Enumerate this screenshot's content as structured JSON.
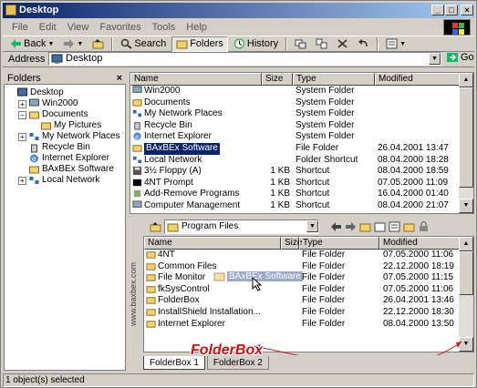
{
  "window": {
    "title": "Desktop"
  },
  "menu": [
    "File",
    "Edit",
    "View",
    "Favorites",
    "Tools",
    "Help"
  ],
  "toolbar": {
    "back": "Back",
    "search": "Search",
    "folders": "Folders",
    "history": "History"
  },
  "address": {
    "label": "Address",
    "value": "Desktop",
    "go": "Go"
  },
  "folders_pane": {
    "title": "Folders",
    "tree": [
      {
        "label": "Desktop",
        "depth": 0,
        "exp": ""
      },
      {
        "label": "Win2000",
        "depth": 1,
        "exp": "+"
      },
      {
        "label": "Documents",
        "depth": 1,
        "exp": "-"
      },
      {
        "label": "My Pictures",
        "depth": 2,
        "exp": ""
      },
      {
        "label": "My Network Places",
        "depth": 1,
        "exp": "+"
      },
      {
        "label": "Recycle Bin",
        "depth": 1,
        "exp": ""
      },
      {
        "label": "Internet Explorer",
        "depth": 1,
        "exp": ""
      },
      {
        "label": "BAxBEx Software",
        "depth": 1,
        "exp": ""
      },
      {
        "label": "Local Network",
        "depth": 1,
        "exp": "+"
      }
    ]
  },
  "list": {
    "columns": [
      "Name",
      "Size",
      "Type",
      "Modified"
    ],
    "rows": [
      {
        "name": "Win2000",
        "size": "",
        "type": "System Folder",
        "modified": ""
      },
      {
        "name": "Documents",
        "size": "",
        "type": "System Folder",
        "modified": ""
      },
      {
        "name": "My Network Places",
        "size": "",
        "type": "System Folder",
        "modified": ""
      },
      {
        "name": "Recycle Bin",
        "size": "",
        "type": "System Folder",
        "modified": ""
      },
      {
        "name": "Internet Explorer",
        "size": "",
        "type": "System Folder",
        "modified": ""
      },
      {
        "name": "BAxBEx Software",
        "size": "",
        "type": "File Folder",
        "modified": "26.04.2001 13:47"
      },
      {
        "name": "Local Network",
        "size": "",
        "type": "Folder Shortcut",
        "modified": "08.04.2000 18:28"
      },
      {
        "name": "3½ Floppy (A)",
        "size": "1 KB",
        "type": "Shortcut",
        "modified": "08.04.2000 18:59"
      },
      {
        "name": "4NT Prompt",
        "size": "1 KB",
        "type": "Shortcut",
        "modified": "07.05.2000 11:09"
      },
      {
        "name": "Add-Remove Programs",
        "size": "1 KB",
        "type": "Shortcut",
        "modified": "16.04.2000 01:40"
      },
      {
        "name": "Computer Management",
        "size": "1 KB",
        "type": "Shortcut",
        "modified": "08.04.2000 21:07"
      }
    ]
  },
  "folderbox": {
    "path": "Program Files",
    "side_label": "www.baxbex.com",
    "columns": [
      "Name",
      "Size",
      "Type",
      "Modified"
    ],
    "rows": [
      {
        "name": "4NT",
        "type": "File Folder",
        "modified": "07.05.2000 11:06"
      },
      {
        "name": "Common Files",
        "type": "File Folder",
        "modified": "22.12.2000 18:19"
      },
      {
        "name": "File Monitor",
        "type": "File Folder",
        "modified": "07.05.2000 11:15"
      },
      {
        "name": "fkSysControl",
        "type": "File Folder",
        "modified": "07.05.2000 11:06"
      },
      {
        "name": "FolderBox",
        "type": "File Folder",
        "modified": "26.04.2001 13:46"
      },
      {
        "name": "InstallShield Installation...",
        "type": "File Folder",
        "modified": "22.12.2000 18:30"
      },
      {
        "name": "Internet Explorer",
        "type": "File Folder",
        "modified": "08.04.2000 13:50"
      }
    ],
    "drag_label": "BAxBEx Software",
    "tabs": [
      "FolderBox 1",
      "FolderBox 2"
    ],
    "brand": "FolderBox"
  },
  "status": "1 object(s) selected",
  "colors": {
    "title_start": "#0a246a",
    "title_end": "#a6caf0",
    "selection": "#0a246a",
    "brand_red": "#d01010",
    "folder_yellow": "#f2d36b"
  }
}
